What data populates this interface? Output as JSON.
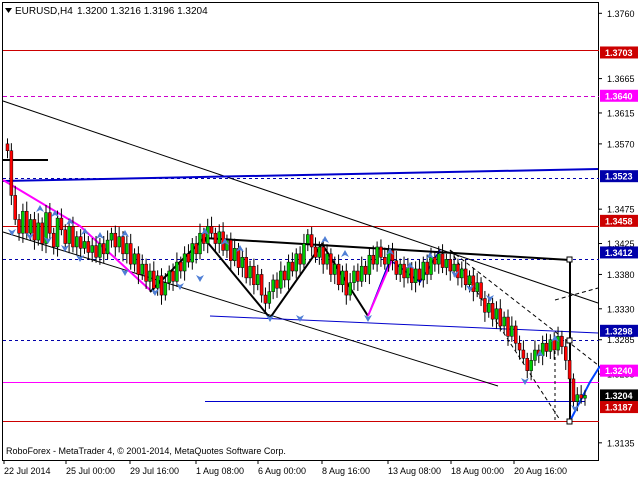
{
  "header": {
    "symbol_tf": "EURUSD,H4",
    "ohlc": "1.3200 1.3216 1.3196 1.3204",
    "dropdown_icon": "triangle-down-icon"
  },
  "footer": {
    "copyright": "RoboForex - MetaTrader 4, © 2001-2014, MetaQuotes Software Corp."
  },
  "colors": {
    "candle_up": "#00cc00",
    "candle_down": "#ff0000",
    "resistance_line": "#cc0000",
    "support_line": "#ff00ff",
    "channel_line": "#0000cc",
    "arrow": "#4f7fd6",
    "trend_line": "#000000"
  },
  "chart_data": {
    "type": "candlestick",
    "symbol": "EURUSD",
    "timeframe": "H4",
    "last_ohlc": {
      "open": 1.32,
      "high": 1.3216,
      "low": 1.3196,
      "close": 1.3204
    },
    "ylim": [
      1.311,
      1.3775
    ],
    "y_ticks": [
      "1.3760",
      "1.3665",
      "1.3615",
      "1.3570",
      "1.3475",
      "1.3425",
      "1.3380",
      "1.3330",
      "1.3285",
      "1.3235",
      "1.3135"
    ],
    "x_ticks": [
      "22 Jul 2014",
      "25 Jul 00:00",
      "29 Jul 16:00",
      "1 Aug 08:00",
      "6 Aug 00:00",
      "8 Aug 16:00",
      "13 Aug 08:00",
      "18 Aug 00:00",
      "20 Aug 16:00"
    ],
    "price_labels": [
      {
        "value": "1.3703",
        "style": "red"
      },
      {
        "value": "1.3640",
        "style": "magenta"
      },
      {
        "value": "1.3523",
        "style": "blue"
      },
      {
        "value": "1.3458",
        "style": "red"
      },
      {
        "value": "1.3412",
        "style": "blue"
      },
      {
        "value": "1.3298",
        "style": "blue"
      },
      {
        "value": "1.3240",
        "style": "magenta"
      },
      {
        "value": "1.3204",
        "style": "current"
      },
      {
        "value": "1.3187",
        "style": "red"
      }
    ],
    "closes": [
      1.356,
      1.3495,
      1.346,
      1.344,
      1.3472,
      1.344,
      1.346,
      1.343,
      1.3455,
      1.3425,
      1.347,
      1.344,
      1.342,
      1.3462,
      1.3445,
      1.3425,
      1.345,
      1.342,
      1.3435,
      1.3418,
      1.3428,
      1.3412,
      1.3422,
      1.3405,
      1.3425,
      1.341,
      1.343,
      1.344,
      1.342,
      1.3435,
      1.341,
      1.3425,
      1.3395,
      1.341,
      1.338,
      1.3395,
      1.337,
      1.3385,
      1.336,
      1.3378,
      1.335,
      1.3368,
      1.3385,
      1.337,
      1.3398,
      1.3385,
      1.341,
      1.3398,
      1.3425,
      1.341,
      1.344,
      1.3425,
      1.345,
      1.344,
      1.3425,
      1.3442,
      1.3415,
      1.343,
      1.34,
      1.3418,
      1.339,
      1.3405,
      1.3375,
      1.3392,
      1.3365,
      1.338,
      1.335,
      1.3338,
      1.3355,
      1.3372,
      1.336,
      1.3385,
      1.3372,
      1.3398,
      1.3385,
      1.341,
      1.3395,
      1.3425,
      1.3438,
      1.342,
      1.3405,
      1.342,
      1.3395,
      1.341,
      1.338,
      1.3395,
      1.3365,
      1.3385,
      1.335,
      1.3368,
      1.3385,
      1.337,
      1.3392,
      1.338,
      1.3408,
      1.3395,
      1.342,
      1.3405,
      1.3395,
      1.3415,
      1.34,
      1.338,
      1.3395,
      1.3375,
      1.339,
      1.3368,
      1.3388,
      1.3372,
      1.3398,
      1.338,
      1.3405,
      1.3395,
      1.341,
      1.339,
      1.3402,
      1.3385,
      1.3395,
      1.3375,
      1.3388,
      1.3365,
      1.3378,
      1.3355,
      1.3368,
      1.3345,
      1.3325,
      1.3338,
      1.3315,
      1.333,
      1.3305,
      1.3318,
      1.329,
      1.3305,
      1.328,
      1.327,
      1.3258,
      1.324,
      1.3255,
      1.327,
      1.3262,
      1.328,
      1.3268,
      1.3285,
      1.327,
      1.329,
      1.3275,
      1.3255,
      1.3228,
      1.3195,
      1.3205,
      1.32,
      1.3204
    ]
  }
}
